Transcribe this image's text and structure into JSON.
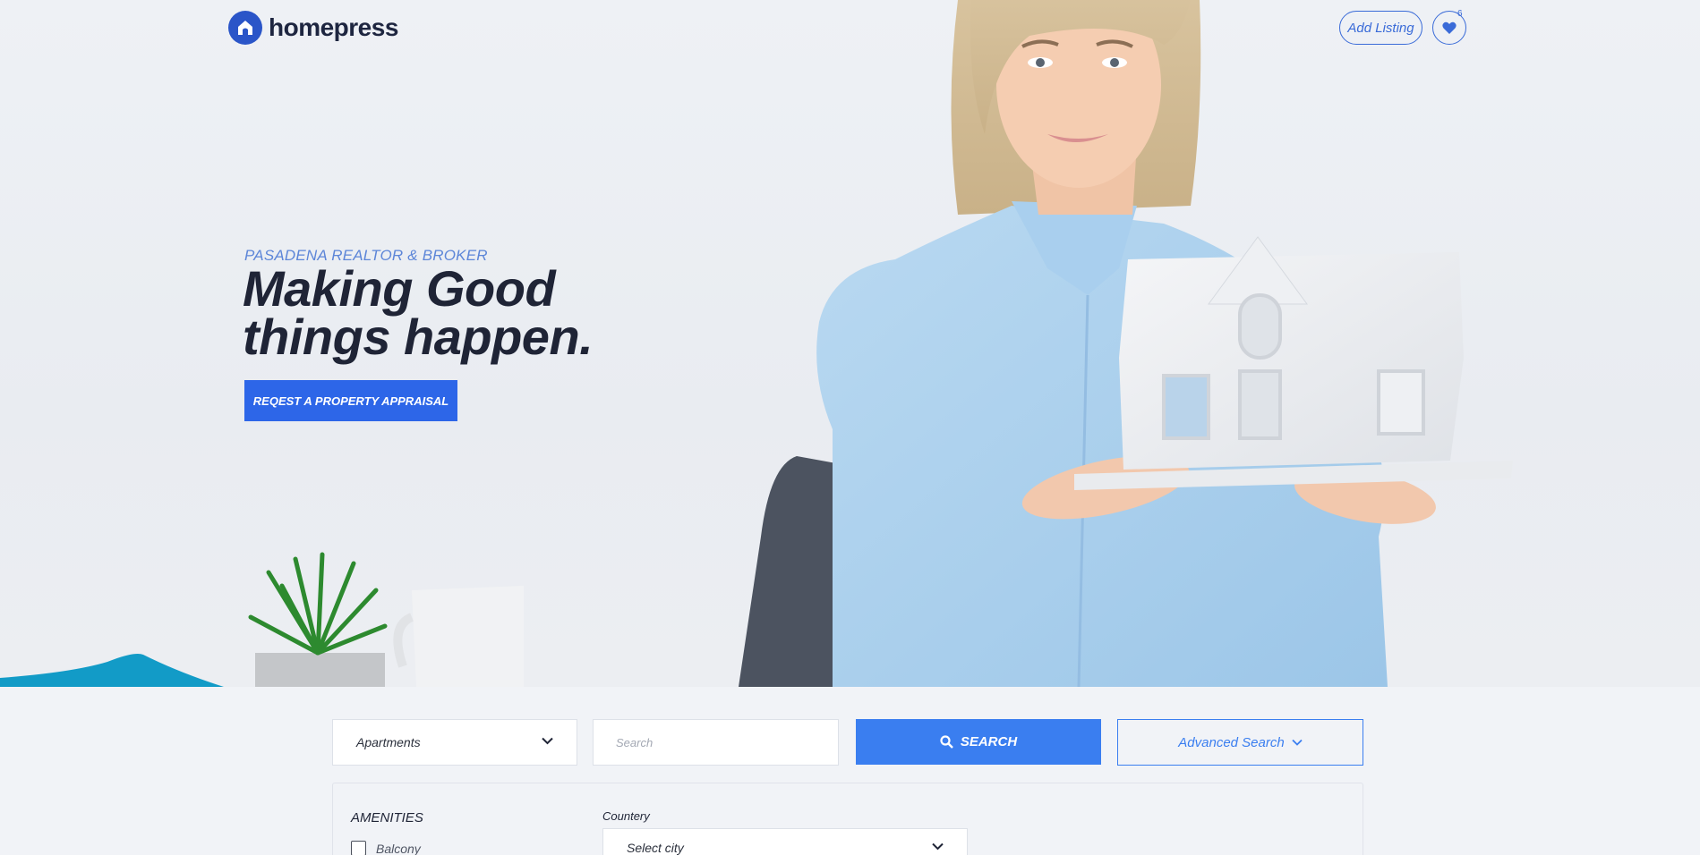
{
  "brand": {
    "name": "homepress",
    "logo_icon": "house-icon",
    "accent": "#2a55c8"
  },
  "header": {
    "add_listing_label": "Add Listing",
    "favorites_icon": "heart-icon",
    "favorites_count": "6"
  },
  "hero": {
    "kicker": "PASADENA REALTOR & BROKER",
    "headline": "Making Good things happen.",
    "cta_label": "REQEST A PROPERTY APPRAISAL",
    "cta_color": "#2d66e8"
  },
  "search": {
    "type_selected": "Apartments",
    "placeholder": "Search",
    "search_label": "SEARCH",
    "advanced_label": "Advanced Search",
    "button_color": "#3a7ef0"
  },
  "advanced": {
    "amenities_title": "AMENITIES",
    "amenities": [
      {
        "label": "Balcony",
        "checked": false
      }
    ],
    "country_label": "Countery",
    "city_selected": "Select city"
  }
}
